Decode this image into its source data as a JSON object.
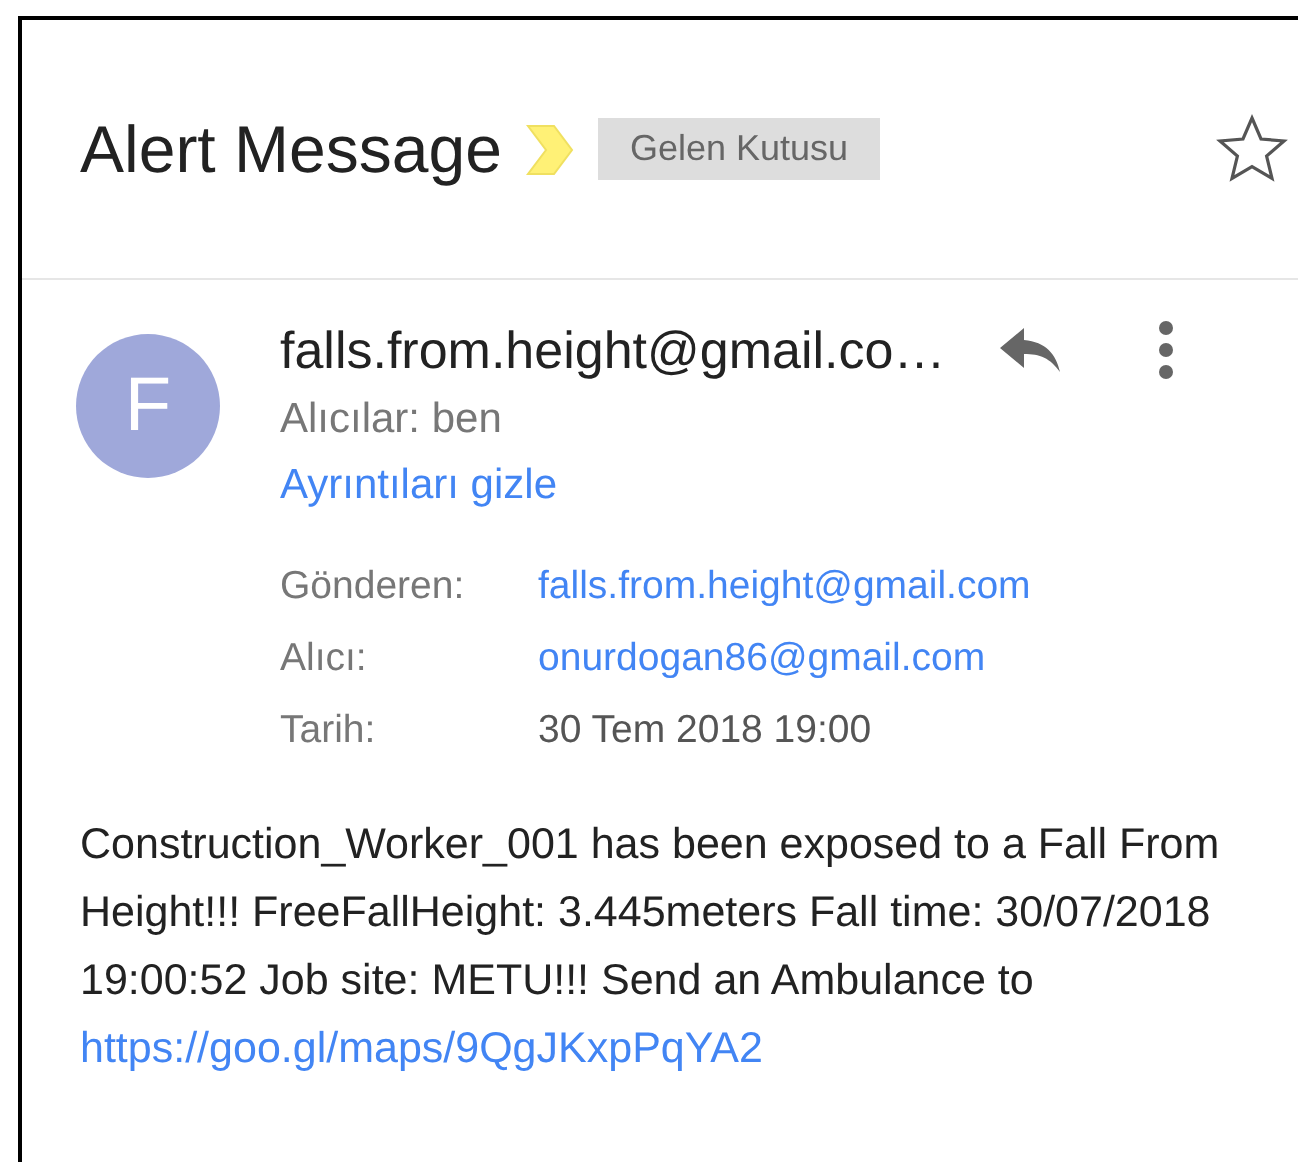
{
  "subject": "Alert Message",
  "important": true,
  "label": "Gelen Kutusu",
  "starred": false,
  "sender": {
    "initial": "F",
    "color": "#9fa8da",
    "name": "falls.from.height@gmail.co…",
    "recipients": "Alıcılar: ben",
    "toggle": "Ayrıntıları gizle"
  },
  "details": [
    {
      "label": "Gönderen:",
      "value": "falls.from.height@gmail.com",
      "kind": "link"
    },
    {
      "label": "Alıcı:",
      "value": "onurdogan86@gmail.com",
      "kind": "link"
    },
    {
      "label": "Tarih:",
      "value": "30 Tem 2018 19:00",
      "kind": "text"
    }
  ],
  "body": {
    "text": "Construction_Worker_001 has been exposed to a Fall From Height!!! FreeFallHeight: 3.445meters Fall time: 30/07/2018 19:00:52 Job site: METU!!! Send an Ambulance to ",
    "link": "https://goo.gl/maps/9QgJKxpPqYA2"
  }
}
